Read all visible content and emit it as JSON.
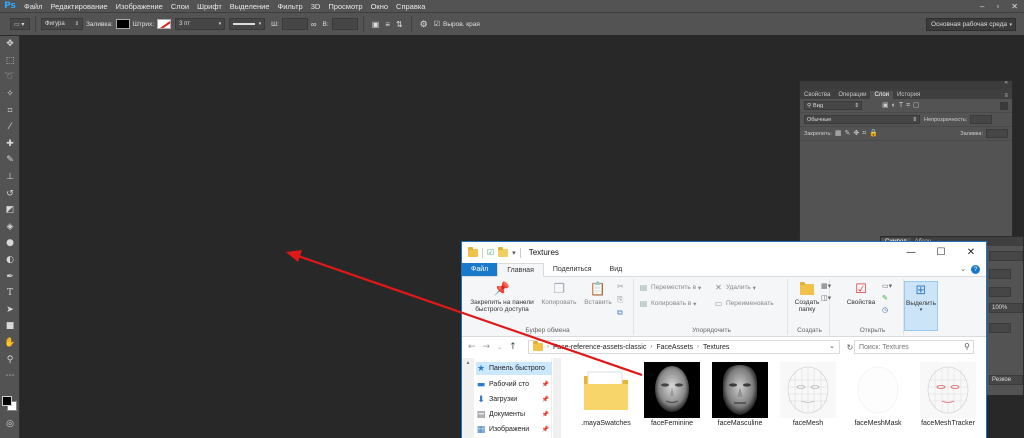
{
  "app": {
    "logo": "Ps"
  },
  "menu": [
    "Файл",
    "Редактирование",
    "Изображение",
    "Слои",
    "Шрифт",
    "Выделение",
    "Фильтр",
    "3D",
    "Просмотр",
    "Окно",
    "Справка"
  ],
  "options": {
    "shape_mode": "Фигура",
    "fill_label": "Заливка:",
    "stroke_label": "Штрих:",
    "stroke_size": "3 пт",
    "width_label": "Ш:",
    "height_label": "В:",
    "align_edges": "Выров. края",
    "workspace": "Основная рабочая среда"
  },
  "layers_panel": {
    "tabs": [
      "Свойства",
      "Операции",
      "Слои",
      "История"
    ],
    "active_tab": "Слои",
    "filter_kind": "Вид",
    "blend_mode": "Обычные",
    "opacity_label": "Непрозрачность:",
    "lock_label": "Закрепить:",
    "fill_label": "Заливка:"
  },
  "char_panel": {
    "tabs": [
      "Символ",
      "Абзац"
    ],
    "value_100": "100%",
    "aa_mode": "Резкое"
  },
  "explorer": {
    "title": "Textures",
    "tabs": {
      "file": "Файл",
      "home": "Главная",
      "share": "Поделиться",
      "view": "Вид"
    },
    "ribbon": {
      "pin_label": "Закрепить на панели быстрого доступа",
      "copy": "Копировать",
      "paste": "Вставить",
      "clipboard_group": "Буфер обмена",
      "move_to": "Переместить в",
      "copy_to": "Копировать в",
      "delete": "Удалить",
      "rename": "Переименовать",
      "organize_group": "Упорядочить",
      "new_folder": "Создать папку",
      "new_group": "Создать",
      "properties": "Свойства",
      "open_group": "Открыть",
      "select": "Выделить"
    },
    "address": {
      "crumbs": [
        "Face-reference-assets-classic",
        "FaceAssets",
        "Textures"
      ]
    },
    "search_placeholder": "Поиск: Textures",
    "nav": [
      {
        "label": "Панель быстрого",
        "icon": "star-icon"
      },
      {
        "label": "Рабочий сто",
        "icon": "desktop-icon"
      },
      {
        "label": "Загрузки",
        "icon": "download-icon"
      },
      {
        "label": "Документы",
        "icon": "documents-icon"
      },
      {
        "label": "Изображени",
        "icon": "pictures-icon"
      }
    ],
    "files": [
      {
        "name": ".mayaSwatches",
        "kind": "folder"
      },
      {
        "name": "faceFeminine",
        "kind": "face-dark"
      },
      {
        "name": "faceMasculine",
        "kind": "face-dark"
      },
      {
        "name": "faceMesh",
        "kind": "mesh"
      },
      {
        "name": "faceMeshMask",
        "kind": "mask"
      },
      {
        "name": "faceMeshTracker",
        "kind": "tracker"
      }
    ]
  },
  "colors": {
    "canvas": "#282828",
    "chrome": "#535353",
    "accent_blue": "#1979ca",
    "arrow": "#e01818"
  }
}
